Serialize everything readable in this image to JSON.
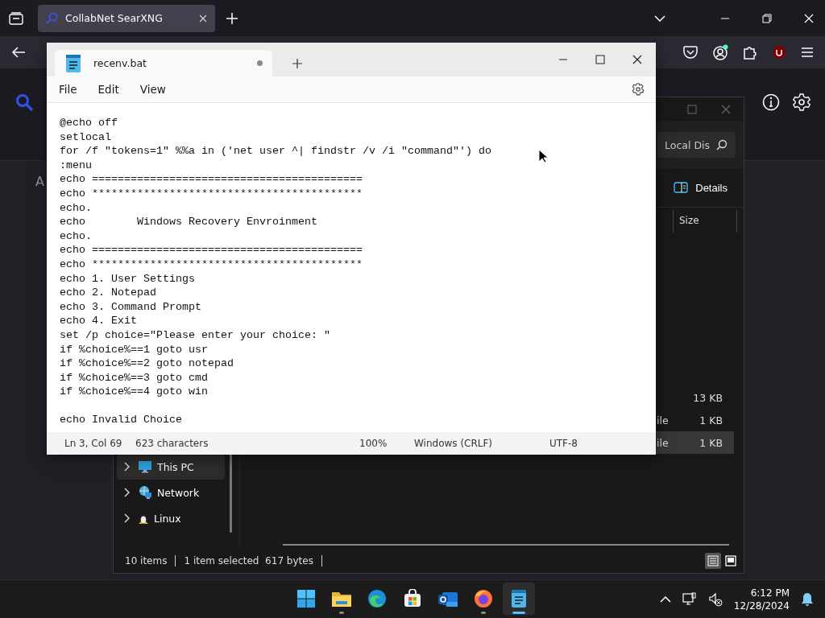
{
  "browser": {
    "tabs": [
      {
        "title": "CollabNet SearXNG",
        "selected": true
      }
    ],
    "page_text": "A"
  },
  "explorer": {
    "search_value": "Local Dis",
    "toolbar_button": "Details",
    "column": "Size",
    "rows": [
      {
        "size": "13 KB",
        "selected": false
      },
      {
        "type": "ile",
        "size": "1 KB",
        "selected": false
      },
      {
        "type": "ile",
        "size": "1 KB",
        "selected": true
      }
    ],
    "nav": [
      {
        "label": "This PC",
        "kind": "pc",
        "selected": true
      },
      {
        "label": "Network",
        "kind": "network",
        "selected": false
      },
      {
        "label": "Linux",
        "kind": "linux",
        "selected": false
      }
    ],
    "status": {
      "count": "10 items",
      "selection": "1 item selected  617 bytes"
    },
    "views": [
      {
        "kind": "details",
        "selected": true
      },
      {
        "kind": "tiles",
        "selected": false
      }
    ]
  },
  "notepad": {
    "tabs": [
      {
        "title": "recenv.bat",
        "selected": true,
        "modified": true
      }
    ],
    "menu": [
      "File",
      "Edit",
      "View"
    ],
    "blocks": [
      [
        "@echo off",
        "setlocal",
        "for /f \"tokens=1\" %%a in ('net user ^| findstr /v /i \"command\"') do",
        ":menu",
        "echo ==========================================",
        "echo ******************************************",
        "echo.",
        "echo        Windows Recovery Envroinment",
        "echo.",
        "echo ==========================================",
        "echo ******************************************",
        "echo 1. User Settings",
        "echo 2. Notepad",
        "echo 3. Command Prompt",
        "echo 4. Exit",
        "set /p choice=\"Please enter your choice: \"",
        "if %choice%==1 goto usr",
        "if %choice%==2 goto notepad",
        "if %choice%==3 goto cmd",
        "if %choice%==4 goto win"
      ],
      [
        "echo Invalid Choice"
      ]
    ],
    "status": [
      "Ln 3, Col 69",
      "623 characters",
      "100%",
      "Windows (CRLF)",
      "UTF-8"
    ]
  },
  "taskbar": {
    "apps": [
      {
        "kind": "start",
        "running": false,
        "selected": false
      },
      {
        "kind": "explorer",
        "running": true,
        "selected": false
      },
      {
        "kind": "edge",
        "running": false,
        "selected": false
      },
      {
        "kind": "store",
        "running": false,
        "selected": false
      },
      {
        "kind": "outlook",
        "running": false,
        "selected": false
      },
      {
        "kind": "firefox",
        "running": true,
        "selected": false
      },
      {
        "kind": "notepad",
        "running": true,
        "selected": true
      }
    ],
    "time": "6:12 PM",
    "date": "12/28/2024"
  }
}
